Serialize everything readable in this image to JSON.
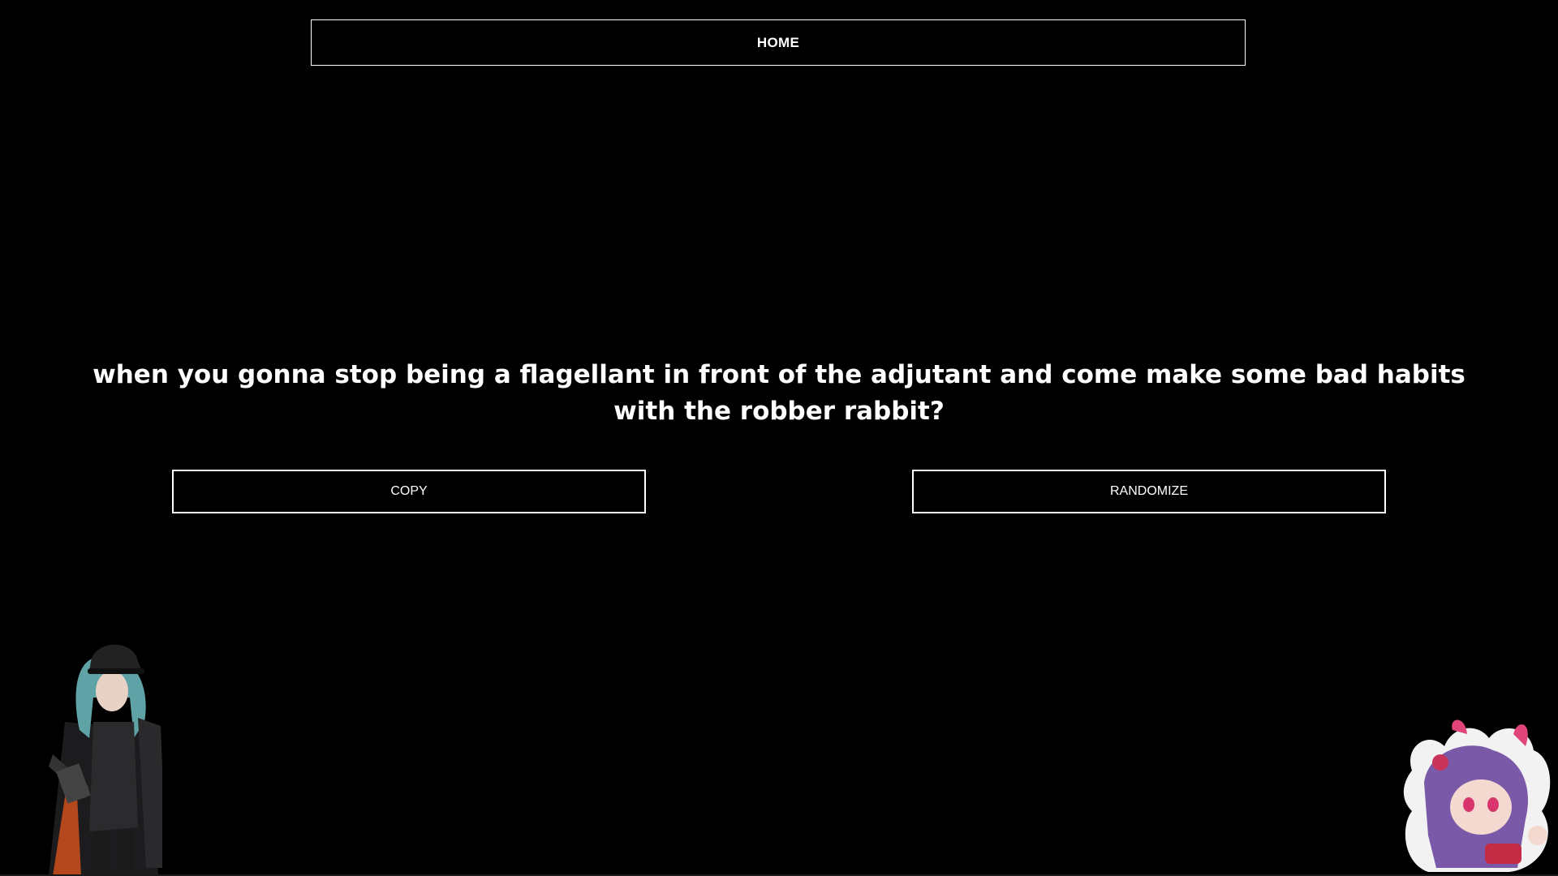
{
  "nav": {
    "home_label": "HOME"
  },
  "main": {
    "quote": "when you gonna stop being a flagellant in front of the adjutant and come make some bad habits with the robber rabbit?",
    "copy_label": "COPY",
    "randomize_label": "RANDOMIZE"
  },
  "decorations": {
    "left_character_icon": "character-portrait-officer",
    "right_character_icon": "chibi-sticker-bunny"
  }
}
